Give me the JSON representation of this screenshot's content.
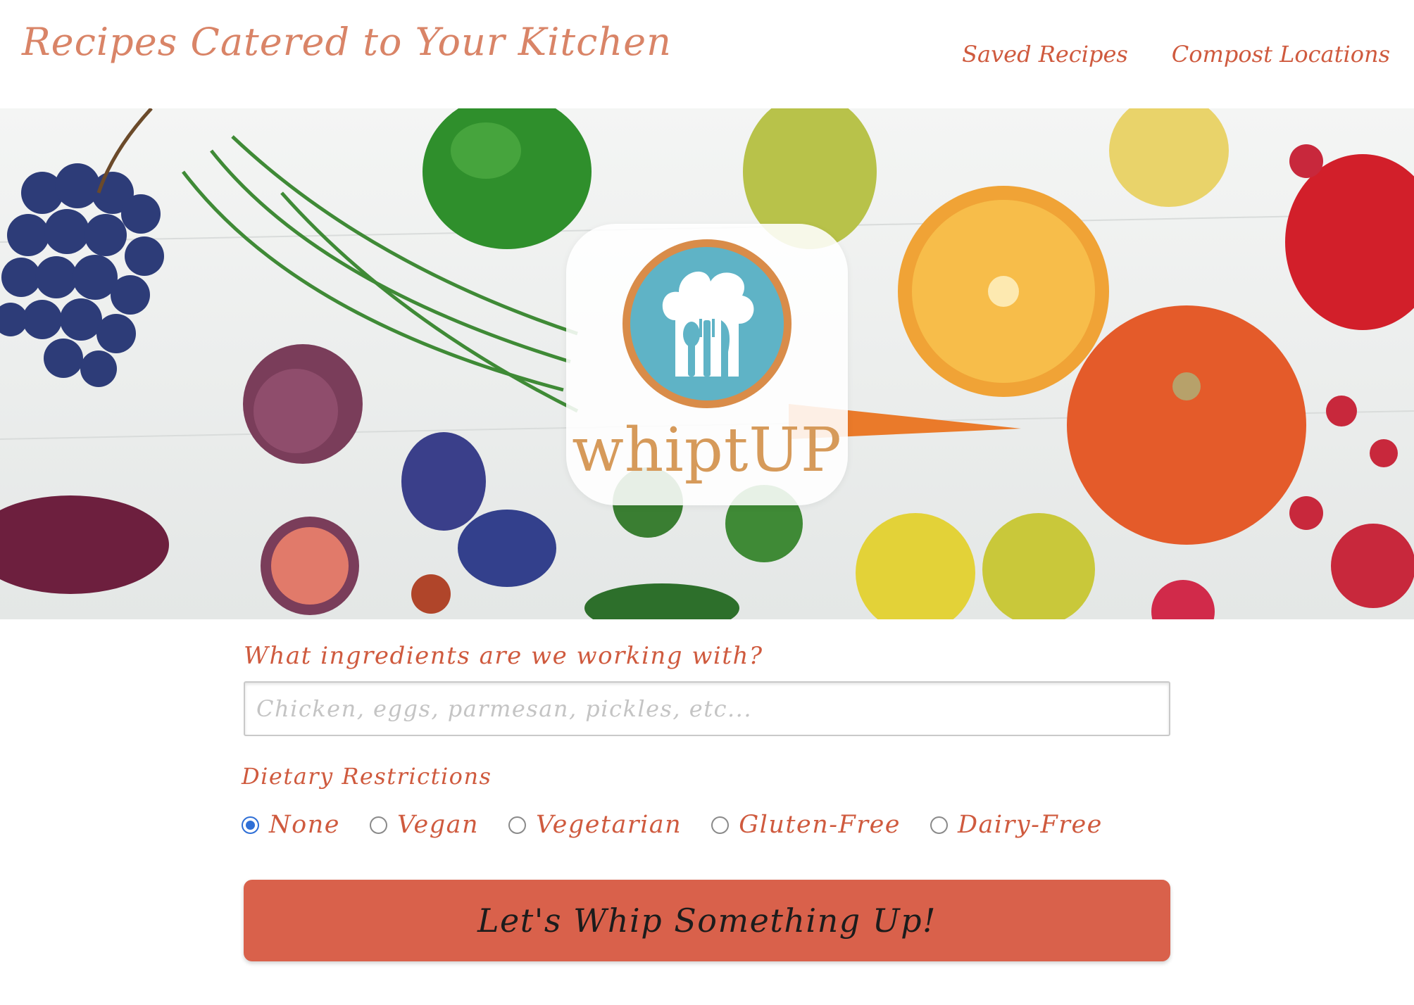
{
  "header": {
    "title": "Recipes Catered to Your Kitchen",
    "nav": [
      {
        "label": "Saved Recipes"
      },
      {
        "label": "Compost Locations"
      }
    ]
  },
  "hero": {
    "logo_text": "whiptUP",
    "logo_icon": "chef-hat-utensils-icon"
  },
  "form": {
    "ingredients_label": "What ingredients are we working with?",
    "ingredients_value": "",
    "ingredients_placeholder": "Chicken, eggs, parmesan, pickles, etc...",
    "dietary_label": "Dietary Restrictions",
    "dietary_options": [
      {
        "label": "None",
        "checked": true
      },
      {
        "label": "Vegan",
        "checked": false
      },
      {
        "label": "Vegetarian",
        "checked": false
      },
      {
        "label": "Gluten-Free",
        "checked": false
      },
      {
        "label": "Dairy-Free",
        "checked": false
      }
    ],
    "submit_label": "Let's Whip Something Up!"
  },
  "colors": {
    "title": "#d98467",
    "accent": "#cf5a3e",
    "button": "#d9614b",
    "radio_selected": "#2f6fd6",
    "logo_ring": "#d98c49",
    "logo_fill": "#5fb3c6"
  }
}
